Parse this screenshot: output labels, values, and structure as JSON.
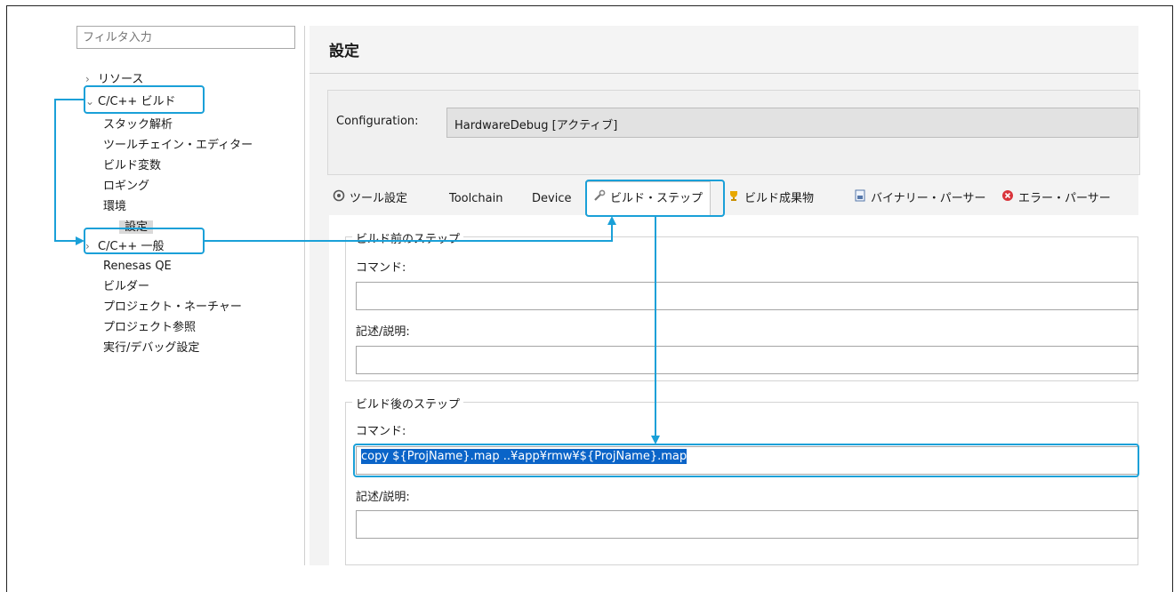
{
  "filter": {
    "placeholder": "フィルタ入力"
  },
  "tree": {
    "resources": "リソース",
    "build": "C/C++ ビルド",
    "stack": "スタック解析",
    "toolchain_editor": "ツールチェイン・エディター",
    "build_vars": "ビルド変数",
    "logging": "ロギング",
    "environment": "環境",
    "settings": "設定",
    "general": "C/C++ 一般",
    "renesas_qe": "Renesas QE",
    "builder": "ビルダー",
    "natures": "プロジェクト・ネーチャー",
    "references": "プロジェクト参照",
    "run_debug": "実行/デバッグ設定"
  },
  "header": {
    "title": "設定"
  },
  "configuration": {
    "label": "Configuration:",
    "value": "HardwareDebug  [アクティブ]"
  },
  "tabs": {
    "tool_settings": "ツール設定",
    "toolchain": "Toolchain",
    "device": "Device",
    "build_steps": "ビルド・ステップ",
    "artifact": "ビルド成果物",
    "binary_parser": "バイナリー・パーサー",
    "error_parser": "エラー・パーサー"
  },
  "prebuild": {
    "group_title": "ビルド前のステップ",
    "command_label": "コマンド:",
    "command_value": "",
    "desc_label": "記述/説明:",
    "desc_value": ""
  },
  "postbuild": {
    "group_title": "ビルド後のステップ",
    "command_label": "コマンド:",
    "command_value": "copy ${ProjName}.map ..¥app¥rmw¥${ProjName}.map",
    "desc_label": "記述/説明:",
    "desc_value": ""
  },
  "colors": {
    "callout": "#1aa0d8",
    "selection": "#0a64c8"
  }
}
